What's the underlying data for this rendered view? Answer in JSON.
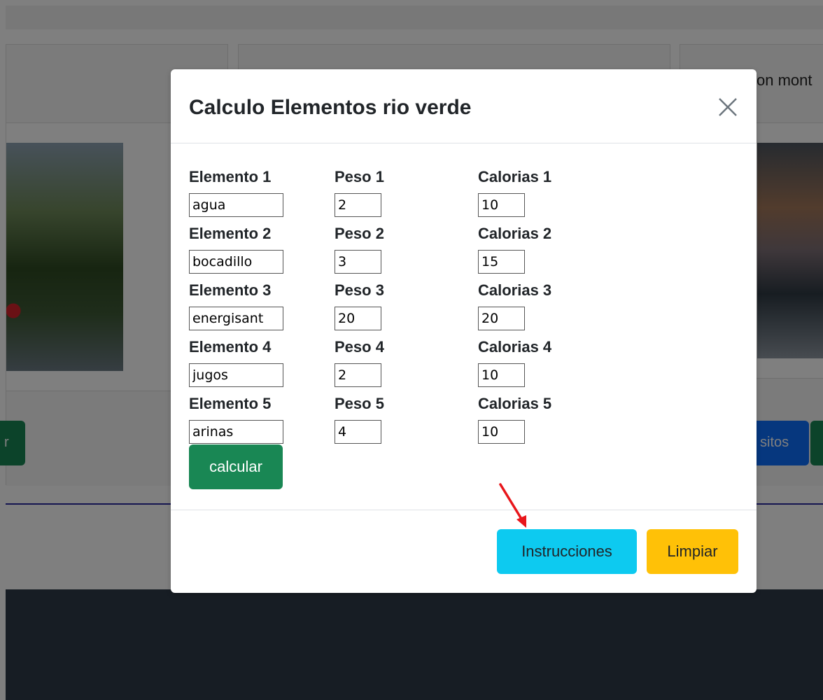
{
  "background": {
    "card_right_title": "on mont",
    "left_button_label": "r",
    "right_button_label": "sitos",
    "colors": {
      "footer": "#2f3a49",
      "link_line": "#2a2aa0"
    }
  },
  "modal": {
    "title": "Calculo Elementos rio verde",
    "close_icon": "close-icon",
    "rows": [
      {
        "elemento_label": "Elemento 1",
        "elemento_value": "agua",
        "peso_label": "Peso 1",
        "peso_value": "2",
        "calorias_label": "Calorias 1",
        "calorias_value": "10"
      },
      {
        "elemento_label": "Elemento 2",
        "elemento_value": "bocadillo",
        "peso_label": "Peso 2",
        "peso_value": "3",
        "calorias_label": "Calorias 2",
        "calorias_value": "15"
      },
      {
        "elemento_label": "Elemento 3",
        "elemento_value": "energisant",
        "peso_label": "Peso 3",
        "peso_value": "20",
        "calorias_label": "Calorias 3",
        "calorias_value": "20"
      },
      {
        "elemento_label": "Elemento 4",
        "elemento_value": "jugos",
        "peso_label": "Peso 4",
        "peso_value": "2",
        "calorias_label": "Calorias 4",
        "calorias_value": "10"
      },
      {
        "elemento_label": "Elemento 5",
        "elemento_value": "arinas",
        "peso_label": "Peso 5",
        "peso_value": "4",
        "calorias_label": "Calorias 5",
        "calorias_value": "10"
      }
    ],
    "calcular_label": "calcular",
    "footer": {
      "instrucciones_label": "Instrucciones",
      "limpiar_label": "Limpiar"
    },
    "colors": {
      "calcular": "#198754",
      "instrucciones": "#0dcaf0",
      "limpiar": "#ffc107",
      "annotation_arrow": "#e8161b"
    }
  }
}
